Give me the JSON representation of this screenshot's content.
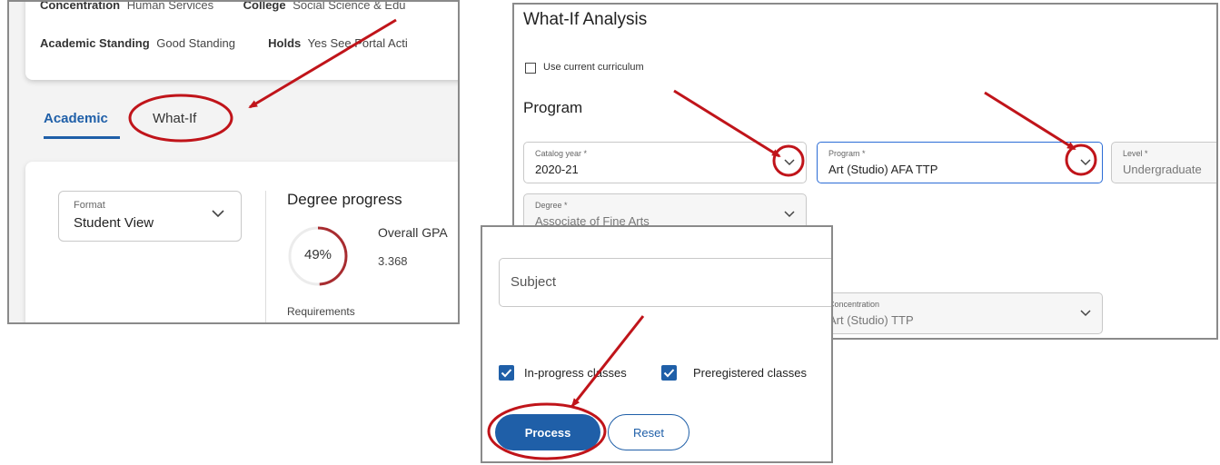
{
  "record": {
    "concentration_label": "Concentration",
    "concentration_value": "Human Services",
    "college_label": "College",
    "college_value": "Social Science & Edu",
    "standing_label": "Academic Standing",
    "standing_value": "Good Standing",
    "holds_label": "Holds",
    "holds_value": "Yes See Portal Acti",
    "tabs": [
      {
        "label": "Academic"
      },
      {
        "label": "What-If"
      }
    ],
    "format": {
      "label": "Format",
      "value": "Student View"
    },
    "degree_progress": {
      "title": "Degree progress",
      "percent_label": "49%",
      "percent": 49,
      "gpa_label": "Overall GPA",
      "gpa_value": "3.368",
      "requirements_label": "Requirements"
    }
  },
  "whatif": {
    "title": "What-If Analysis",
    "use_current_label": "Use current curriculum",
    "program_heading": "Program",
    "fields": {
      "catalog_year": {
        "label": "Catalog year *",
        "value": "2020-21"
      },
      "program": {
        "label": "Program *",
        "value": "Art (Studio) AFA TTP"
      },
      "level": {
        "label": "Level *",
        "value": "Undergraduate"
      },
      "degree": {
        "label": "Degree *",
        "value": "Associate of Fine Arts"
      },
      "concentration": {
        "label": "Concentration",
        "value": "Art (Studio) TTP"
      }
    }
  },
  "process_panel": {
    "subject_placeholder": "Subject",
    "in_progress_label": "In-progress classes",
    "preregistered_label": "Preregistered classes",
    "process_label": "Process",
    "reset_label": "Reset"
  },
  "colors": {
    "accent": "#1f5fa8",
    "annotation": "#c0141a",
    "panel_border": "#8a8a8a"
  }
}
